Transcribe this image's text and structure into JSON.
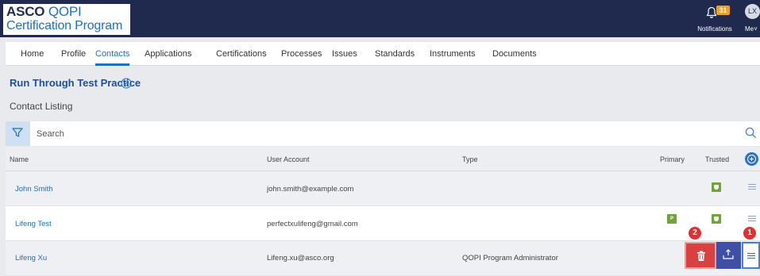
{
  "header": {
    "logo": {
      "line1_bold": "ASCO",
      "line1_light": "QOPI",
      "line2": "Certification Program"
    },
    "notifications": {
      "count": "31",
      "label": "Notifications",
      "icon": "bell-icon"
    },
    "user": {
      "initials": "LX",
      "label": "Me"
    }
  },
  "tabs": [
    {
      "label": "Home"
    },
    {
      "label": "Profile"
    },
    {
      "label": "Contacts",
      "active": true
    },
    {
      "label": "Applications"
    },
    {
      "label": "Certifications"
    },
    {
      "label": "Processes"
    },
    {
      "label": "Issues"
    },
    {
      "label": "Standards"
    },
    {
      "label": "Instruments"
    },
    {
      "label": "Documents"
    }
  ],
  "page": {
    "title": "Run Through Test Practice",
    "section": "Contact Listing"
  },
  "search": {
    "placeholder": "Search",
    "value": ""
  },
  "table": {
    "columns": [
      "Name",
      "User Account",
      "Type",
      "Primary",
      "Trusted"
    ],
    "rows": [
      {
        "name": "John Smith",
        "account": "john.smith@example.com",
        "type": "",
        "primary": false,
        "trusted": true
      },
      {
        "name": "Lifeng Test",
        "account": "perfectxulifeng@gmail.com",
        "type": "",
        "primary": true,
        "primary_badge": "P",
        "trusted": true
      },
      {
        "name": "Lifeng Xu",
        "account": "Lifeng.xu@asco.org",
        "type": "QOPI Program Administrator",
        "primary": false,
        "trusted": false
      }
    ]
  },
  "annotations": {
    "marker1": "1",
    "marker2": "2"
  },
  "colors": {
    "header_bg": "#1f2a4e",
    "accent": "#1f6fc0",
    "badge_green": "#6ea43a",
    "delete_red": "#d94040",
    "export_blue": "#3f4fa6"
  }
}
